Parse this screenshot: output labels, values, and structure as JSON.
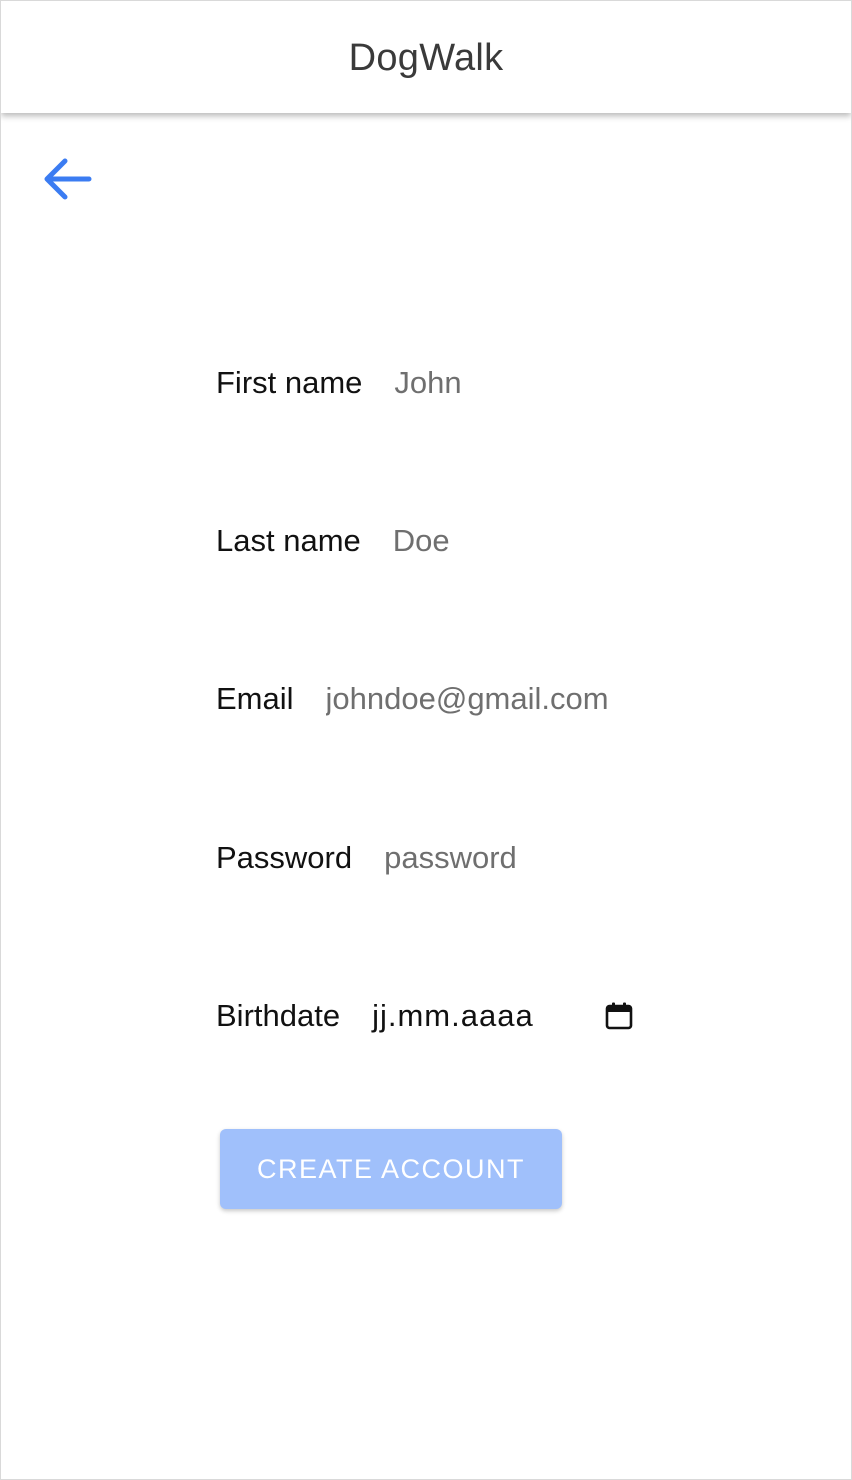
{
  "header": {
    "title": "DogWalk"
  },
  "back_button": {
    "icon": "arrow-left-icon",
    "color": "#3b7cf2"
  },
  "form": {
    "fields": [
      {
        "label": "First name",
        "placeholder": "John",
        "value": ""
      },
      {
        "label": "Last name",
        "placeholder": "Doe",
        "value": ""
      },
      {
        "label": "Email",
        "placeholder": "johndoe@gmail.com",
        "value": ""
      },
      {
        "label": "Password",
        "placeholder": "password",
        "value": ""
      }
    ],
    "birthdate": {
      "label": "Birthdate",
      "value": "jj.mm.aaaa",
      "icon": "calendar-icon"
    },
    "submit_label": "CREATE ACCOUNT",
    "submit_color": "#a0c0fb"
  }
}
